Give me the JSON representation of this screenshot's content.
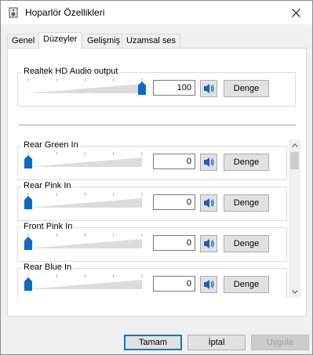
{
  "window": {
    "title": "Hoparlör Özellikleri",
    "icons": {
      "app": "speaker-properties-icon",
      "close": "close-icon"
    }
  },
  "tabs": [
    {
      "label": "Genel",
      "active": false
    },
    {
      "label": "Düzeyler",
      "active": true
    },
    {
      "label": "Gelişmiş",
      "active": false
    },
    {
      "label": "Uzamsal ses",
      "active": false
    }
  ],
  "master": {
    "label": "Realtek HD Audio output",
    "value": "100",
    "level": 1.0,
    "balance_label": "Denge"
  },
  "channels": [
    {
      "label": "Rear Green In",
      "value": "0",
      "level": 0.0,
      "balance_label": "Denge"
    },
    {
      "label": "Rear Pink In",
      "value": "0",
      "level": 0.0,
      "balance_label": "Denge"
    },
    {
      "label": "Front Pink In",
      "value": "0",
      "level": 0.0,
      "balance_label": "Denge"
    },
    {
      "label": "Rear Blue In",
      "value": "0",
      "level": 0.0,
      "balance_label": "Denge"
    }
  ],
  "buttons": {
    "ok": "Tamam",
    "cancel": "İptal",
    "apply": "Uygula"
  },
  "colors": {
    "accent": "#0078d7",
    "thumb": "#0a6bc9",
    "track": "#dcdcdc"
  }
}
